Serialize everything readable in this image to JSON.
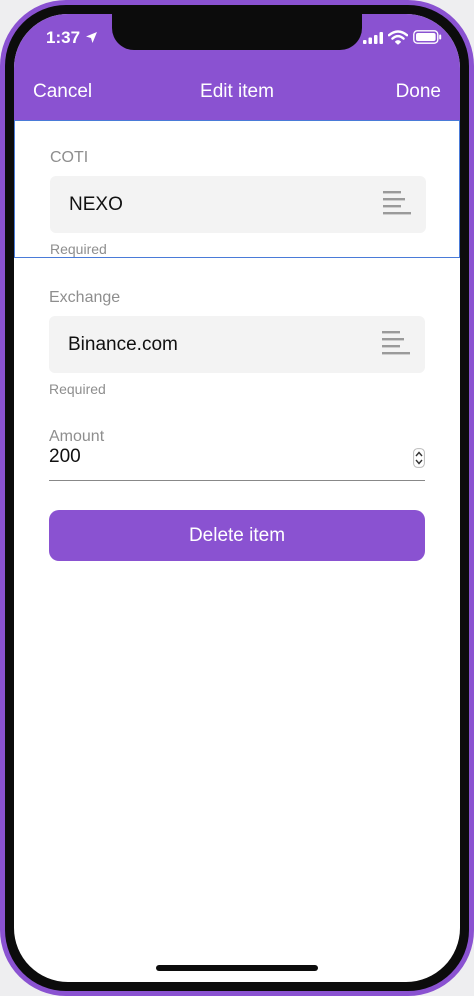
{
  "status_bar": {
    "time": "1:37",
    "icons": [
      "location-arrow-icon",
      "signal-icon",
      "wifi-icon",
      "battery-icon"
    ]
  },
  "header": {
    "cancel_label": "Cancel",
    "title": "Edit item",
    "done_label": "Done"
  },
  "form": {
    "coti": {
      "label": "COTI",
      "value": "NEXO",
      "helper": "Required",
      "icon": "list-icon"
    },
    "exchange": {
      "label": "Exchange",
      "value": "Binance.com",
      "helper": "Required",
      "icon": "list-icon"
    },
    "amount": {
      "label": "Amount",
      "value": "200",
      "icon": "stepper-icon"
    }
  },
  "actions": {
    "delete_label": "Delete item"
  },
  "colors": {
    "accent": "#8a52d1",
    "focus_border": "#4a7bd8",
    "field_bg": "#f3f3f3",
    "label_gray": "#8e8e8e"
  }
}
